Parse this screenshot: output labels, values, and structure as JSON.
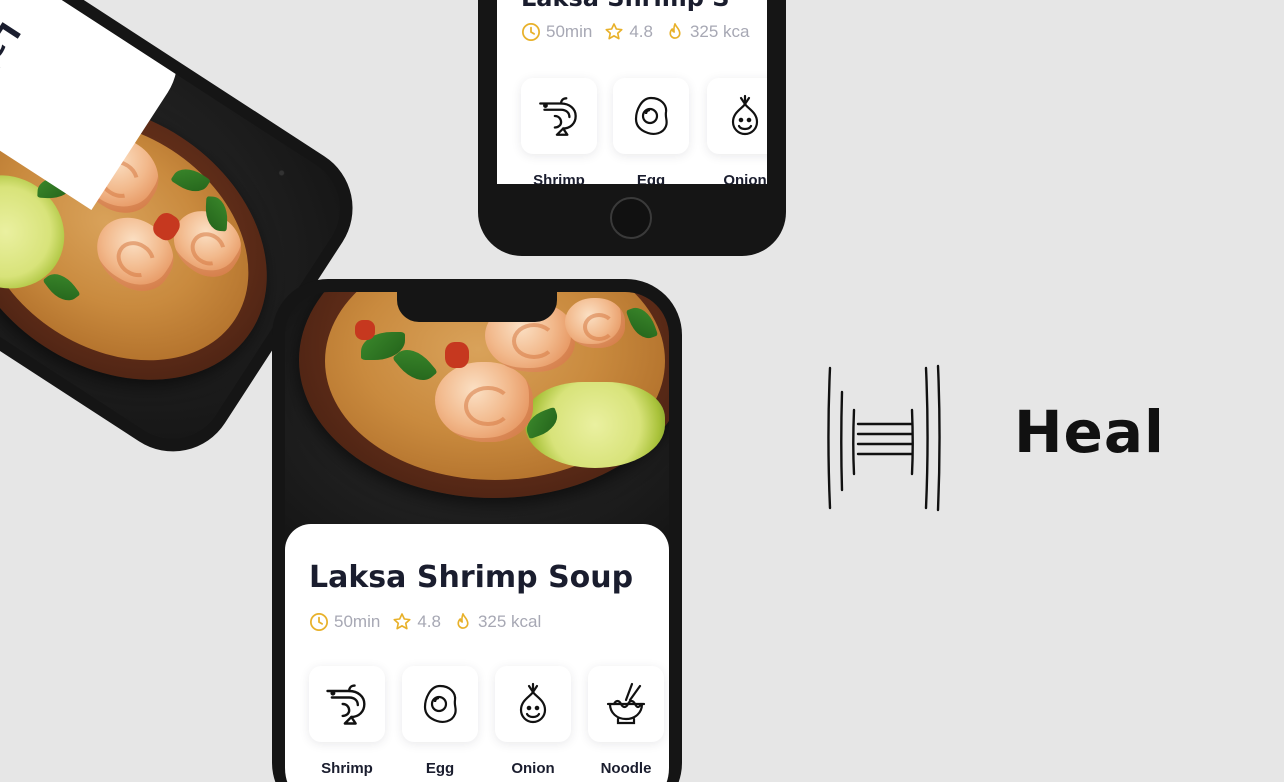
{
  "brand": {
    "name": "Heal"
  },
  "recipe": {
    "title": "Laksa Shrimp Soup",
    "title_partial": "Laksa Shrimp S",
    "title_rotated": "Laksa Shri",
    "time": "50min",
    "rating": "4.8",
    "calories": "325 kcal",
    "calories_partial": "325 kca",
    "ingredients": [
      {
        "label": "Shrimp",
        "icon": "shrimp-icon"
      },
      {
        "label": "Egg",
        "icon": "egg-icon"
      },
      {
        "label": "Onion",
        "icon": "onion-icon"
      },
      {
        "label": "Noodle",
        "icon": "noodle-icon"
      }
    ]
  },
  "colors": {
    "background": "#e6e6e6",
    "accent": "#e8b12a",
    "title": "#1a1d2e",
    "muted": "#a7a8b4",
    "phone_frame": "#151515"
  }
}
